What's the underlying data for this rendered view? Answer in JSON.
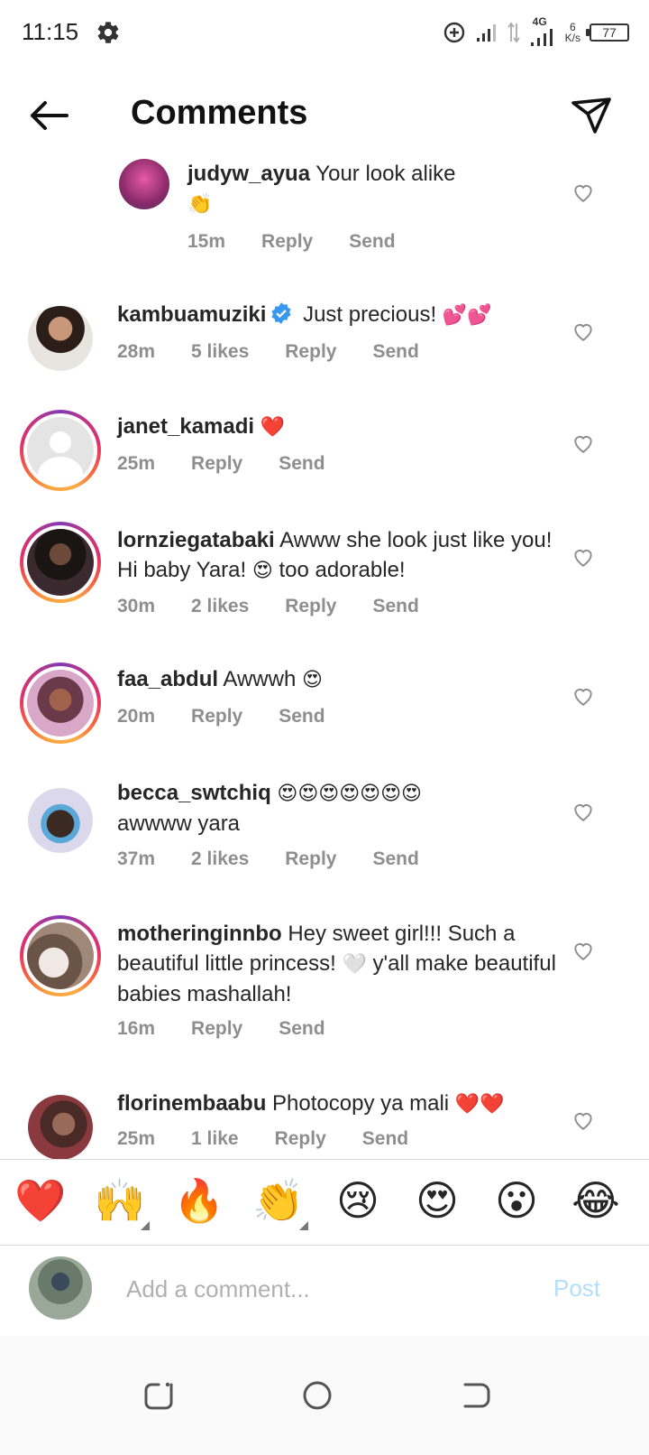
{
  "status_bar": {
    "time": "11:15",
    "network": "4G",
    "speed_value": "6",
    "speed_unit": "K/s",
    "battery": "77"
  },
  "header": {
    "title": "Comments"
  },
  "comments": [
    {
      "username": "judyw_ayua",
      "text": "Your look alike",
      "emoji": "👏",
      "time": "15m",
      "likes": "",
      "reply": "Reply",
      "send": "Send"
    },
    {
      "username": "kambuamuziki",
      "verified": true,
      "text": "Just precious!",
      "emoji": "💕💕",
      "time": "28m",
      "likes": "5 likes",
      "reply": "Reply",
      "send": "Send"
    },
    {
      "username": "janet_kamadi",
      "text": "",
      "emoji": "❤️",
      "time": "25m",
      "likes": "",
      "reply": "Reply",
      "send": "Send"
    },
    {
      "username": "lornziegatabaki",
      "text": "Awww she look just like you! Hi baby Yara!",
      "emoji": "😍",
      "text2": "too adorable!",
      "time": "30m",
      "likes": "2 likes",
      "reply": "Reply",
      "send": "Send"
    },
    {
      "username": "faa_abdul",
      "text": "Awwwh",
      "emoji": "😍",
      "time": "20m",
      "likes": "",
      "reply": "Reply",
      "send": "Send"
    },
    {
      "username": "becca_swtchiq",
      "emoji": "😍😍😍😍😍😍😍",
      "text": "awwww yara",
      "time": "37m",
      "likes": "2 likes",
      "reply": "Reply",
      "send": "Send"
    },
    {
      "username": "motheringinnbo",
      "text": "Hey sweet girl!!! Such a beautiful little princess!",
      "emoji": "🤍",
      "text2": "y'all make beautiful babies mashallah!",
      "time": "16m",
      "likes": "",
      "reply": "Reply",
      "send": "Send"
    },
    {
      "username": "florinembaabu",
      "text": "Photocopy ya mali",
      "emoji": "❤️❤️",
      "time": "25m",
      "likes": "1 like",
      "reply": "Reply",
      "send": "Send"
    }
  ],
  "quick_emojis": [
    "❤️",
    "🙌",
    "🔥",
    "👏",
    "😢",
    "😍",
    "😮",
    "😂"
  ],
  "composer": {
    "placeholder": "Add a comment...",
    "post_label": "Post"
  },
  "colors": {
    "meta": "#8e8e8e",
    "post_disabled": "#b2dffc",
    "verified": "#3897f0"
  }
}
